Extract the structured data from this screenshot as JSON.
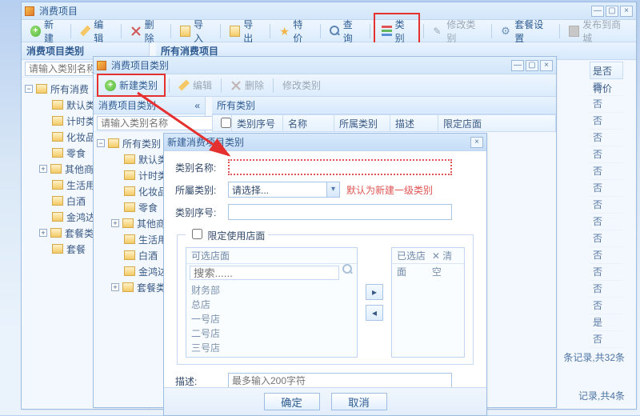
{
  "win1": {
    "title": "消费项目",
    "toolbar": {
      "new": "新建",
      "edit": "编辑",
      "delete": "删除",
      "import": "导入",
      "export": "导出",
      "special": "特价",
      "query": "查询",
      "category": "类别",
      "editcat": "修改类别",
      "setmeal": "套餐设置",
      "publish": "发布到商城"
    },
    "sidepanel_title": "消费项目类别",
    "filter_placeholder": "请输入类别名称",
    "tree": [
      "所有消费",
      "默认类",
      "计时类",
      "化妆品",
      "零食",
      "其他商",
      "生活用",
      "白酒",
      "金鸿达",
      "套餐类",
      "套餐"
    ],
    "right_title": "所有消费项目",
    "bg_header": "是否特价",
    "bg_cells": [
      "否",
      "否",
      "否",
      "否",
      "否",
      "否",
      "否",
      "否",
      "否",
      "否",
      "否",
      "否",
      "否",
      "否",
      "是",
      "否"
    ],
    "pager1": "条记录,共32条",
    "pager2": "记录,共4条"
  },
  "win2": {
    "title": "消费项目类别",
    "toolbar": {
      "newcat": "新建类别",
      "edit": "编辑",
      "delete": "删除",
      "editcat": "修改类别"
    },
    "left_title": "消费项目类别",
    "filter_placeholder": "请输入类别名称",
    "tree": [
      "所有类别",
      "默认类",
      "计时类",
      "化妆品",
      "零食",
      "其他商",
      "生活用",
      "白酒",
      "金鸿达",
      "套餐类"
    ],
    "right_title": "所有类别",
    "thead": [
      "",
      "类别序号",
      "名称",
      "所属类别",
      "描述",
      "限定店面"
    ]
  },
  "win3": {
    "title": "新建消费项目类别",
    "lbl_name": "类别名称:",
    "lbl_parent": "所屬类别:",
    "parent_value": "请选择...",
    "parent_note": "默认为新建一级类别",
    "lbl_seq": "类别序号:",
    "chk_limit": "限定使用店面",
    "left_title": "可选店面",
    "right_title": "已选店面",
    "clear": "清空",
    "search_ph": "搜索......",
    "stores": [
      "财务部",
      "总店",
      "一号店",
      "二号店",
      "三号店"
    ],
    "lbl_desc": "描述:",
    "desc_ph": "最多输入200字符",
    "ok": "确定",
    "cancel": "取消"
  }
}
